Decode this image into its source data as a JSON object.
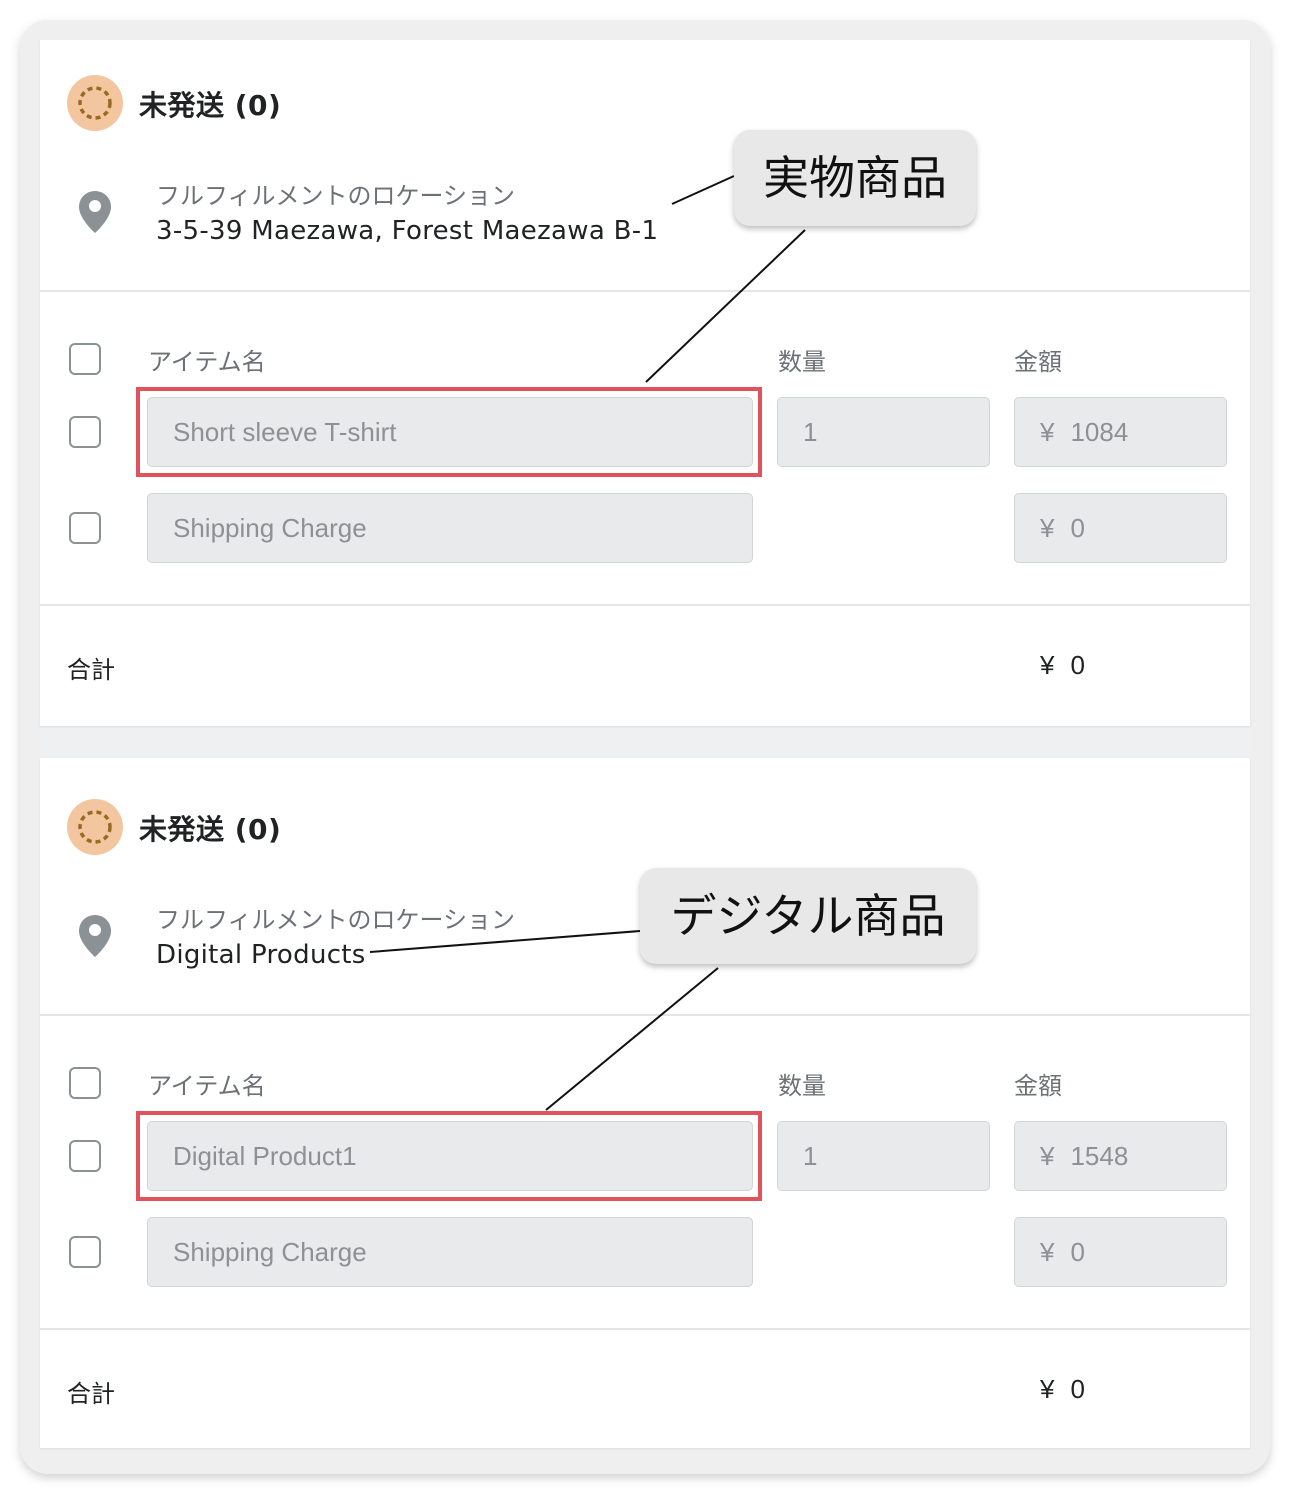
{
  "sections": [
    {
      "status_title": "未発送 (0)",
      "location_label": "フルフィルメントのロケーション",
      "location_value": "3-5-39 Maezawa, Forest Maezawa B-1",
      "columns": {
        "item": "アイテム名",
        "qty": "数量",
        "amount": "金額"
      },
      "rows": [
        {
          "name": "Short sleeve T-shirt",
          "qty": "1",
          "currency": "¥",
          "amount": "1084"
        },
        {
          "name": "Shipping Charge",
          "currency": "¥",
          "amount": "0"
        }
      ],
      "total_label": "合計",
      "total_currency": "¥",
      "total_value": "0",
      "callout": "実物商品"
    },
    {
      "status_title": "未発送 (0)",
      "location_label": "フルフィルメントのロケーション",
      "location_value": "Digital Products",
      "columns": {
        "item": "アイテム名",
        "qty": "数量",
        "amount": "金額"
      },
      "rows": [
        {
          "name": "Digital Product1",
          "qty": "1",
          "currency": "¥",
          "amount": "1548"
        },
        {
          "name": "Shipping Charge",
          "currency": "¥",
          "amount": "0"
        }
      ],
      "total_label": "合計",
      "total_currency": "¥",
      "total_value": "0",
      "callout": "デジタル商品"
    }
  ],
  "colors": {
    "highlight": "#e0535c",
    "status_icon_fill": "#f3c6a0",
    "status_icon_dash": "#9a6a20",
    "field_bg": "#e9eaec"
  },
  "icons": {
    "status": "unfulfilled-status-icon",
    "location": "location-pin-icon"
  }
}
